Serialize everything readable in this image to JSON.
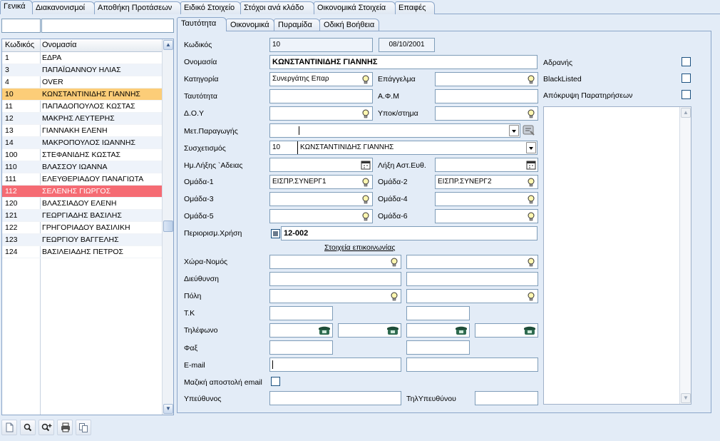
{
  "top_tabs": [
    "Γενικά",
    "Διακανονισμοί",
    "Αποθήκη Προτάσεων",
    "Ειδικό Στοιχείο",
    "Στόχοι ανά κλάδο",
    "Οικονομικά Στοιχεία",
    "Επαφές"
  ],
  "list": {
    "search_code": "",
    "search_name": "",
    "col_code": "Κωδικός",
    "col_name": "Ονομασία",
    "rows": [
      {
        "code": "1",
        "name": "ΕΔΡΑ"
      },
      {
        "code": "3",
        "name": "ΠΑΠΑΪΩΑΝΝΟΥ ΗΛΙΑΣ"
      },
      {
        "code": "4",
        "name": "OVER"
      },
      {
        "code": "10",
        "name": "ΚΩΝΣΤΑΝΤΙΝΙΔΗΣ ΓΙΑΝΝΗΣ"
      },
      {
        "code": "11",
        "name": "ΠΑΠΑΔΟΠΟΥΛΟΣ ΚΩΣΤΑΣ"
      },
      {
        "code": "12",
        "name": "ΜΑΚΡΗΣ ΛΕΥΤΕΡΗΣ"
      },
      {
        "code": "13",
        "name": "ΓΙΑΝΝΑΚΗ ΕΛΕΝΗ"
      },
      {
        "code": "14",
        "name": "ΜΑΚΡΟΠΟΥΛΟΣ ΙΩΑΝΝΗΣ"
      },
      {
        "code": "100",
        "name": "ΣΤΕΦΑΝΙΔΗΣ ΚΩΣΤΑΣ"
      },
      {
        "code": "110",
        "name": "ΒΛΑΣΣΟΥ ΙΩΑΝΝΑ"
      },
      {
        "code": "111",
        "name": "ΕΛΕΥΘΕΡΙΑΔΟΥ ΠΑΝΑΓΙΩΤΑ"
      },
      {
        "code": "112",
        "name": "ΣΕΛΕΝΗΣ ΓΙΩΡΓΟΣ"
      },
      {
        "code": "120",
        "name": "ΒΛΑΣΣΙΑΔΟΥ ΕΛΕΝΗ"
      },
      {
        "code": "121",
        "name": "ΓΕΩΡΓΙΑΔΗΣ ΒΑΣΙΛΗΣ"
      },
      {
        "code": "122",
        "name": "ΓΡΗΓΟΡΙΑΔΟΥ ΒΑΣΙΛΙΚΗ"
      },
      {
        "code": "123",
        "name": "ΓΕΩΡΓΙΟΥ ΒΑΓΓΕΛΗΣ"
      },
      {
        "code": "124",
        "name": "ΒΑΣΙΛΕΙΑΔΗΣ ΠΕΤΡΟΣ"
      }
    ]
  },
  "sub_tabs": [
    "Ταυτότητα",
    "Οικονομικά",
    "Πυραμίδα",
    "Οδική Βοήθεια"
  ],
  "form": {
    "code_label": "Κωδικός",
    "code": "10",
    "date": "08/10/2001",
    "name_label": "Ονομασία",
    "name": "ΚΩΝΣΤΑΝΤΙΝΙΔΗΣ ΓΙΑΝΝΗΣ",
    "category_label": "Κατηγορία",
    "category": "Συνεργάτης Επαρ",
    "profession_label": "Επάγγελμα",
    "profession": "",
    "id_label": "Ταυτότητα",
    "id": "",
    "afm_label": "Α.Φ.Μ",
    "afm": "",
    "doy_label": "Δ.Ο.Υ",
    "doy": "",
    "branch_label": "Υποκ/στημα",
    "branch": "",
    "transfer_label": "Μετ.Παραγωγής",
    "transfer": "",
    "assoc_label": "Συσχετισμός",
    "assoc_code": "10",
    "assoc_name": "ΚΩΝΣΤΑΝΤΙΝΙΔΗΣ ΓΙΑΝΝΗΣ",
    "license_exp_label": "Ημ.Λήξης `Αδειας",
    "license_exp": "",
    "civil_exp_label": "Λήξη Αστ.Ευθ.",
    "civil_exp": "",
    "group1_label": "Ομάδα-1",
    "group1": "ΕΙΣΠΡ.ΣΥΝΕΡΓ1",
    "group2_label": "Ομάδα-2",
    "group2": "ΕΙΣΠΡ.ΣΥΝΕΡΓ2",
    "group3_label": "Ομάδα-3",
    "group3": "",
    "group4_label": "Ομάδα-4",
    "group4": "",
    "group5_label": "Ομάδα-5",
    "group5": "",
    "group6_label": "Ομάδα-6",
    "group6": "",
    "restrict_label": "Περιορισμ.Χρήση",
    "restrict_value": "12-002",
    "contact_header": "Στοιχεία επικοινωνίας",
    "country_label": "Χώρα-Νομός",
    "address_label": "Διεύθυνση",
    "city_label": "Πόλη",
    "zip_label": "Τ.Κ",
    "phone_label": "Τηλέφωνο",
    "fax_label": "Φαξ",
    "email_label": "E-mail",
    "mass_email_label": "Μαζική αποστολή email",
    "responsible_label": "Υπεύθυνος",
    "responsible_phone_label": "ΤηλΥπευθύνου"
  },
  "flags": {
    "inactive_label": "Αδρανής",
    "blacklisted_label": "BlackListed",
    "hide_notes_label": "Απόκρυψη Παρατηρήσεων"
  },
  "colors": {
    "selected_orange": "#fccd78",
    "selected_red": "#f56b73",
    "panel_bg": "#e3ecf7"
  }
}
